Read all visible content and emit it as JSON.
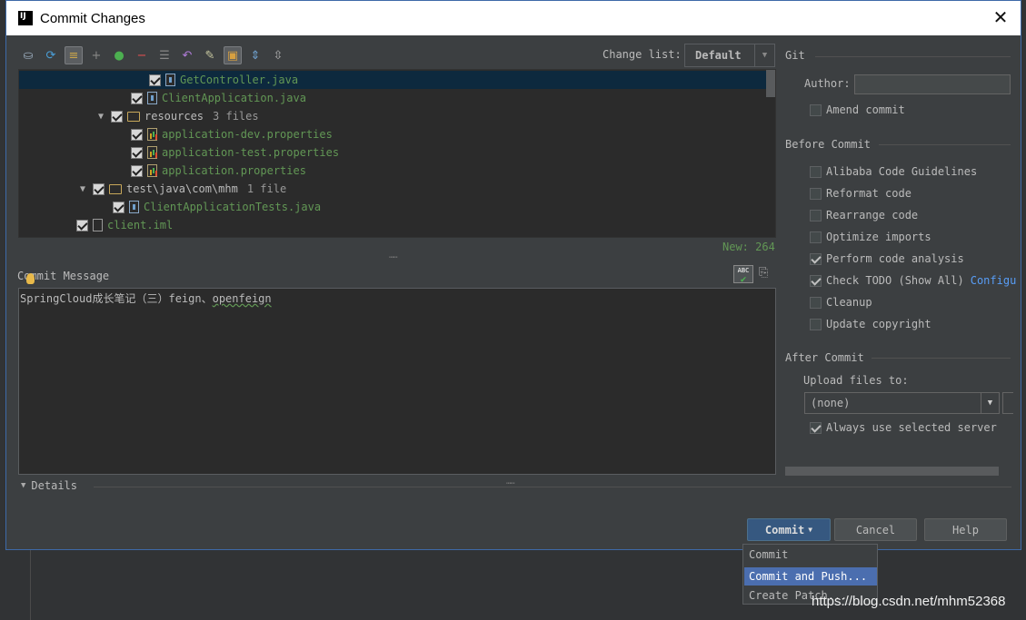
{
  "window": {
    "title": "Commit Changes"
  },
  "toolbar": {
    "icons": [
      "lock-icon",
      "refresh-icon",
      "diff-icon",
      "plus-icon",
      "move-icon",
      "minus-icon",
      "group-icon",
      "revert-icon",
      "edit-icon",
      "preview-icon",
      "expand-icon",
      "collapse-icon"
    ],
    "changelist_label": "Change list:",
    "changelist_value": "Default"
  },
  "tree": {
    "rows": [
      {
        "name": "GetController.java",
        "kind": "java"
      },
      {
        "name": "ClientApplication.java",
        "kind": "java"
      },
      {
        "name": "resources",
        "count": "3 files",
        "kind": "folder"
      },
      {
        "name": "application-dev.properties",
        "kind": "props"
      },
      {
        "name": "application-test.properties",
        "kind": "props"
      },
      {
        "name": "application.properties",
        "kind": "props"
      },
      {
        "name": "test\\java\\com\\mhm",
        "count": "1 file",
        "kind": "folder"
      },
      {
        "name": "ClientApplicationTests.java",
        "kind": "java"
      },
      {
        "name": "client.iml",
        "kind": "iml"
      }
    ],
    "new_count": "New: 264"
  },
  "commit_message": {
    "label": "Commit Message",
    "text_a": "SpringCloud成长笔记（三）feign、",
    "text_b": "openfeign"
  },
  "details": {
    "label": "Details"
  },
  "git": {
    "section": "Git",
    "author_label": "Author:",
    "author_value": "",
    "amend_label": "Amend commit"
  },
  "before_commit": {
    "section": "Before Commit",
    "options": [
      {
        "label": "Alibaba Code Guidelines",
        "checked": false
      },
      {
        "label": "Reformat code",
        "checked": false
      },
      {
        "label": "Rearrange code",
        "checked": false
      },
      {
        "label": "Optimize imports",
        "checked": false
      },
      {
        "label": "Perform code analysis",
        "checked": true
      },
      {
        "label": "Check TODO (Show All)",
        "checked": true,
        "link": "Configu"
      },
      {
        "label": "Cleanup",
        "checked": false
      },
      {
        "label": "Update copyright",
        "checked": false
      }
    ]
  },
  "after_commit": {
    "section": "After Commit",
    "upload_label": "Upload files to:",
    "server_value": "(none)",
    "always_label": "Always use selected server"
  },
  "buttons": {
    "commit": "Commit",
    "cancel": "Cancel",
    "help": "Help"
  },
  "popup": {
    "items": [
      "Commit",
      "Commit and Push...",
      "Create Patch..."
    ]
  },
  "watermark": "https://blog.csdn.net/mhm52368",
  "colors": {
    "accent": "#365880",
    "highlight": "#4b6eaf",
    "added_file": "#629755",
    "link": "#589df6"
  }
}
